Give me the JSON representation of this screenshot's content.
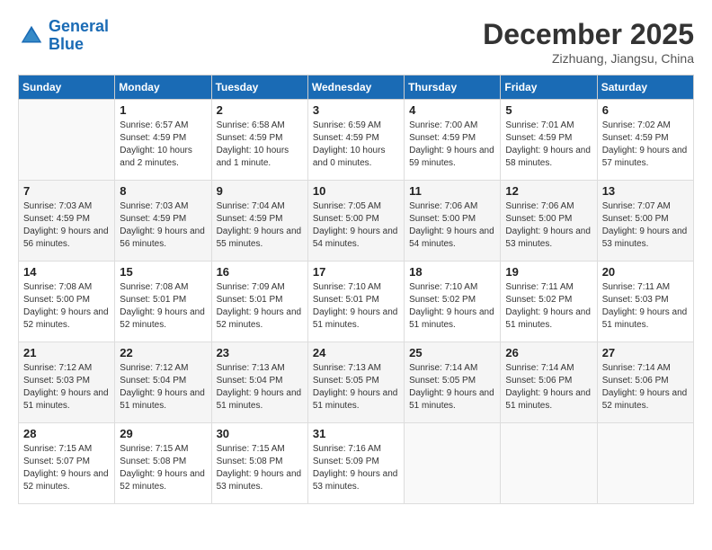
{
  "header": {
    "logo_line1": "General",
    "logo_line2": "Blue",
    "month": "December 2025",
    "location": "Zizhuang, Jiangsu, China"
  },
  "weekdays": [
    "Sunday",
    "Monday",
    "Tuesday",
    "Wednesday",
    "Thursday",
    "Friday",
    "Saturday"
  ],
  "weeks": [
    [
      {
        "day": "",
        "sunrise": "",
        "sunset": "",
        "daylight": ""
      },
      {
        "day": "1",
        "sunrise": "Sunrise: 6:57 AM",
        "sunset": "Sunset: 4:59 PM",
        "daylight": "Daylight: 10 hours and 2 minutes."
      },
      {
        "day": "2",
        "sunrise": "Sunrise: 6:58 AM",
        "sunset": "Sunset: 4:59 PM",
        "daylight": "Daylight: 10 hours and 1 minute."
      },
      {
        "day": "3",
        "sunrise": "Sunrise: 6:59 AM",
        "sunset": "Sunset: 4:59 PM",
        "daylight": "Daylight: 10 hours and 0 minutes."
      },
      {
        "day": "4",
        "sunrise": "Sunrise: 7:00 AM",
        "sunset": "Sunset: 4:59 PM",
        "daylight": "Daylight: 9 hours and 59 minutes."
      },
      {
        "day": "5",
        "sunrise": "Sunrise: 7:01 AM",
        "sunset": "Sunset: 4:59 PM",
        "daylight": "Daylight: 9 hours and 58 minutes."
      },
      {
        "day": "6",
        "sunrise": "Sunrise: 7:02 AM",
        "sunset": "Sunset: 4:59 PM",
        "daylight": "Daylight: 9 hours and 57 minutes."
      }
    ],
    [
      {
        "day": "7",
        "sunrise": "Sunrise: 7:03 AM",
        "sunset": "Sunset: 4:59 PM",
        "daylight": "Daylight: 9 hours and 56 minutes."
      },
      {
        "day": "8",
        "sunrise": "Sunrise: 7:03 AM",
        "sunset": "Sunset: 4:59 PM",
        "daylight": "Daylight: 9 hours and 56 minutes."
      },
      {
        "day": "9",
        "sunrise": "Sunrise: 7:04 AM",
        "sunset": "Sunset: 4:59 PM",
        "daylight": "Daylight: 9 hours and 55 minutes."
      },
      {
        "day": "10",
        "sunrise": "Sunrise: 7:05 AM",
        "sunset": "Sunset: 5:00 PM",
        "daylight": "Daylight: 9 hours and 54 minutes."
      },
      {
        "day": "11",
        "sunrise": "Sunrise: 7:06 AM",
        "sunset": "Sunset: 5:00 PM",
        "daylight": "Daylight: 9 hours and 54 minutes."
      },
      {
        "day": "12",
        "sunrise": "Sunrise: 7:06 AM",
        "sunset": "Sunset: 5:00 PM",
        "daylight": "Daylight: 9 hours and 53 minutes."
      },
      {
        "day": "13",
        "sunrise": "Sunrise: 7:07 AM",
        "sunset": "Sunset: 5:00 PM",
        "daylight": "Daylight: 9 hours and 53 minutes."
      }
    ],
    [
      {
        "day": "14",
        "sunrise": "Sunrise: 7:08 AM",
        "sunset": "Sunset: 5:00 PM",
        "daylight": "Daylight: 9 hours and 52 minutes."
      },
      {
        "day": "15",
        "sunrise": "Sunrise: 7:08 AM",
        "sunset": "Sunset: 5:01 PM",
        "daylight": "Daylight: 9 hours and 52 minutes."
      },
      {
        "day": "16",
        "sunrise": "Sunrise: 7:09 AM",
        "sunset": "Sunset: 5:01 PM",
        "daylight": "Daylight: 9 hours and 52 minutes."
      },
      {
        "day": "17",
        "sunrise": "Sunrise: 7:10 AM",
        "sunset": "Sunset: 5:01 PM",
        "daylight": "Daylight: 9 hours and 51 minutes."
      },
      {
        "day": "18",
        "sunrise": "Sunrise: 7:10 AM",
        "sunset": "Sunset: 5:02 PM",
        "daylight": "Daylight: 9 hours and 51 minutes."
      },
      {
        "day": "19",
        "sunrise": "Sunrise: 7:11 AM",
        "sunset": "Sunset: 5:02 PM",
        "daylight": "Daylight: 9 hours and 51 minutes."
      },
      {
        "day": "20",
        "sunrise": "Sunrise: 7:11 AM",
        "sunset": "Sunset: 5:03 PM",
        "daylight": "Daylight: 9 hours and 51 minutes."
      }
    ],
    [
      {
        "day": "21",
        "sunrise": "Sunrise: 7:12 AM",
        "sunset": "Sunset: 5:03 PM",
        "daylight": "Daylight: 9 hours and 51 minutes."
      },
      {
        "day": "22",
        "sunrise": "Sunrise: 7:12 AM",
        "sunset": "Sunset: 5:04 PM",
        "daylight": "Daylight: 9 hours and 51 minutes."
      },
      {
        "day": "23",
        "sunrise": "Sunrise: 7:13 AM",
        "sunset": "Sunset: 5:04 PM",
        "daylight": "Daylight: 9 hours and 51 minutes."
      },
      {
        "day": "24",
        "sunrise": "Sunrise: 7:13 AM",
        "sunset": "Sunset: 5:05 PM",
        "daylight": "Daylight: 9 hours and 51 minutes."
      },
      {
        "day": "25",
        "sunrise": "Sunrise: 7:14 AM",
        "sunset": "Sunset: 5:05 PM",
        "daylight": "Daylight: 9 hours and 51 minutes."
      },
      {
        "day": "26",
        "sunrise": "Sunrise: 7:14 AM",
        "sunset": "Sunset: 5:06 PM",
        "daylight": "Daylight: 9 hours and 51 minutes."
      },
      {
        "day": "27",
        "sunrise": "Sunrise: 7:14 AM",
        "sunset": "Sunset: 5:06 PM",
        "daylight": "Daylight: 9 hours and 52 minutes."
      }
    ],
    [
      {
        "day": "28",
        "sunrise": "Sunrise: 7:15 AM",
        "sunset": "Sunset: 5:07 PM",
        "daylight": "Daylight: 9 hours and 52 minutes."
      },
      {
        "day": "29",
        "sunrise": "Sunrise: 7:15 AM",
        "sunset": "Sunset: 5:08 PM",
        "daylight": "Daylight: 9 hours and 52 minutes."
      },
      {
        "day": "30",
        "sunrise": "Sunrise: 7:15 AM",
        "sunset": "Sunset: 5:08 PM",
        "daylight": "Daylight: 9 hours and 53 minutes."
      },
      {
        "day": "31",
        "sunrise": "Sunrise: 7:16 AM",
        "sunset": "Sunset: 5:09 PM",
        "daylight": "Daylight: 9 hours and 53 minutes."
      },
      {
        "day": "",
        "sunrise": "",
        "sunset": "",
        "daylight": ""
      },
      {
        "day": "",
        "sunrise": "",
        "sunset": "",
        "daylight": ""
      },
      {
        "day": "",
        "sunrise": "",
        "sunset": "",
        "daylight": ""
      }
    ]
  ]
}
